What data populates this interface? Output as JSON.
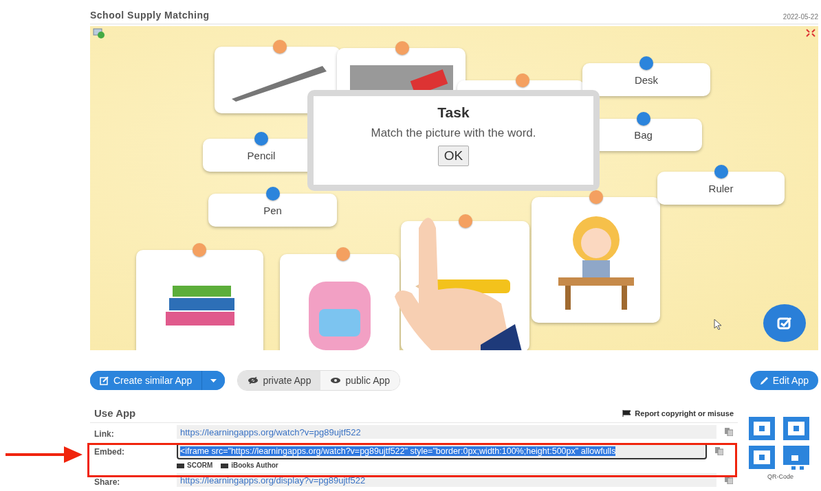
{
  "header": {
    "title": "School Supply Matching",
    "date": "2022-05-22"
  },
  "game": {
    "word_cards": [
      {
        "label": "Desk"
      },
      {
        "label": "Bag"
      },
      {
        "label": "Pencil"
      },
      {
        "label": "Ruler"
      },
      {
        "label": "Pen"
      }
    ],
    "dialog": {
      "title": "Task",
      "message": "Match the picture with the word.",
      "button": "OK"
    }
  },
  "actions": {
    "create": "Create similar App",
    "visibility": [
      {
        "label": "private App",
        "selected": true
      },
      {
        "label": "public App",
        "selected": false
      }
    ],
    "edit": "Edit App"
  },
  "use_app": {
    "heading": "Use App",
    "report": "Report copyright or misuse",
    "rows": [
      {
        "kind": "link",
        "label": "Link:",
        "value": "https://learningapps.org/watch?v=pg89ujtf522"
      },
      {
        "kind": "embed",
        "label": "Embed:",
        "value": "<iframe src=\"https://learningapps.org/watch?v=pg89ujtf522\" style=\"border:0px;width:100%;height:500px\" allowfulls",
        "extras": [
          "SCORM",
          "iBooks Author"
        ]
      },
      {
        "kind": "link",
        "label": "Share:",
        "value": "https://learningapps.org/display?v=pg89ujtf522"
      }
    ],
    "qr_label": "QR-Code"
  }
}
